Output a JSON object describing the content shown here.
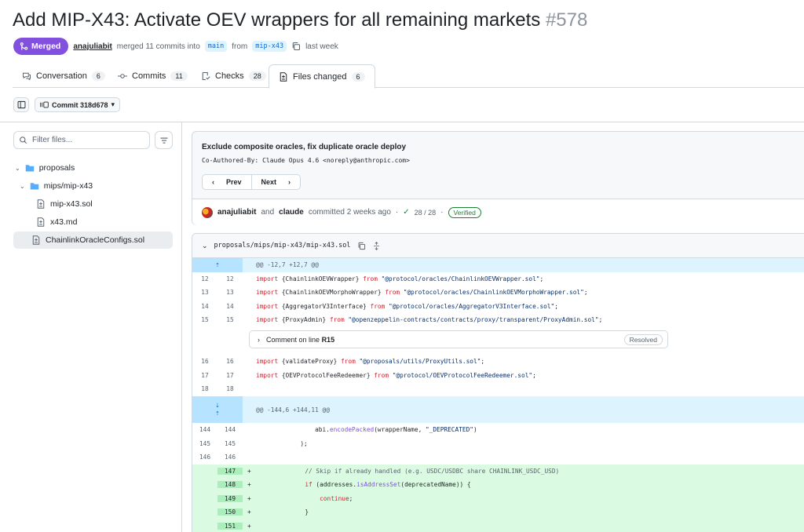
{
  "pr": {
    "title": "Add MIP-X43: Activate OEV wrappers for all remaining markets",
    "number": "#578",
    "status": "Merged",
    "author": "anajuliabit",
    "merged_text": "merged 11 commits into",
    "base_branch": "main",
    "from_text": "from",
    "head_branch": "mip-x43",
    "when": "last week"
  },
  "tabs": [
    {
      "label": "Conversation",
      "count": "6"
    },
    {
      "label": "Commits",
      "count": "11"
    },
    {
      "label": "Checks",
      "count": "28"
    },
    {
      "label": "Files changed",
      "count": "6"
    }
  ],
  "toolbar": {
    "commit_label": "Commit 318d678"
  },
  "sidebar": {
    "filter_placeholder": "Filter files...",
    "tree": [
      {
        "label": "proposals"
      },
      {
        "label": "mips/mip-x43"
      },
      {
        "label": "mip-x43.sol"
      },
      {
        "label": "x43.md"
      },
      {
        "label": "ChainlinkOracleConfigs.sol"
      }
    ]
  },
  "commit": {
    "title": "Exclude composite oracles, fix duplicate oracle deploy",
    "description": "Co-Authored-By: Claude Opus 4.6 <noreply@anthropic.com>",
    "prev": "Prev",
    "next": "Next",
    "author1": "anajuliabit",
    "and": "and",
    "author2": "claude",
    "committed": "committed 2 weeks ago",
    "dot": "·",
    "checks": "28 / 28",
    "verified": "Verified"
  },
  "diff": {
    "path": "proposals/mips/mip-x43/mip-x43.sol",
    "hunk1": "@@ -12,7 +12,7 @@",
    "hunk2": "@@ -144,6 +144,11 @@",
    "comment_label": "Comment on line",
    "comment_line": "R15",
    "resolved": "Resolved",
    "lines": [
      {
        "l": "12",
        "r": "12",
        "kw": "import",
        "mid": " {ChainlinkOEVWrapper} ",
        "kw2": "from",
        "str": " \"@protocol/oracles/ChainlinkOEVWrapper.sol\"",
        "end": ";"
      },
      {
        "l": "13",
        "r": "13",
        "kw": "import",
        "mid": " {ChainlinkOEVMorphoWrapper} ",
        "kw2": "from",
        "str": " \"@protocol/oracles/ChainlinkOEVMorphoWrapper.sol\"",
        "end": ";"
      },
      {
        "l": "14",
        "r": "14",
        "kw": "import",
        "mid": " {AggregatorV3Interface} ",
        "kw2": "from",
        "str": " \"@protocol/oracles/AggregatorV3Interface.sol\"",
        "end": ";"
      },
      {
        "l": "15",
        "r": "15",
        "kw": "import",
        "mid": " {ProxyAdmin} ",
        "kw2": "from",
        "str": " \"@openzeppelin-contracts/contracts/proxy/transparent/ProxyAdmin.sol\"",
        "end": ";"
      },
      {
        "l": "16",
        "r": "16",
        "kw": "import",
        "mid": " {validateProxy} ",
        "kw2": "from",
        "str": " \"@proposals/utils/ProxyUtils.sol\"",
        "end": ";"
      },
      {
        "l": "17",
        "r": "17",
        "kw": "import",
        "mid": " {OEVProtocolFeeRedeemer} ",
        "kw2": "from",
        "str": " \"@protocol/OEVProtocolFeeRedeemer.sol\"",
        "end": ";"
      },
      {
        "l": "18",
        "r": "18"
      }
    ],
    "lines2": [
      {
        "l": "144",
        "r": "144",
        "pre": "                abi.",
        "fn": "encodePacked",
        "rest": "(wrapperName, ",
        "str": "\"_DEPRECATED\"",
        "end": ")"
      },
      {
        "l": "145",
        "r": "145",
        "pre": "            );"
      },
      {
        "l": "146",
        "r": "146"
      }
    ],
    "added": [
      {
        "r": "147",
        "sign": "+",
        "comment": "            // Skip if already handled (e.g. USDC/USDBC share CHAINLINK_USDC_USD)"
      },
      {
        "r": "148",
        "sign": "+",
        "pre": "            ",
        "kw": "if",
        "mid": " (addresses.",
        "fn": "isAddressSet",
        "rest": "(deprecatedName)) {"
      },
      {
        "r": "149",
        "sign": "+",
        "pre": "                ",
        "kw": "continue",
        "rest": ";"
      },
      {
        "r": "150",
        "sign": "+",
        "pre": "            }"
      },
      {
        "r": "151",
        "sign": "+"
      }
    ]
  },
  "colors": {
    "merged": "#8250df",
    "add_bg": "#dafbe1",
    "hunk_bg": "#ddf4ff",
    "verified": "#1a7f37"
  }
}
